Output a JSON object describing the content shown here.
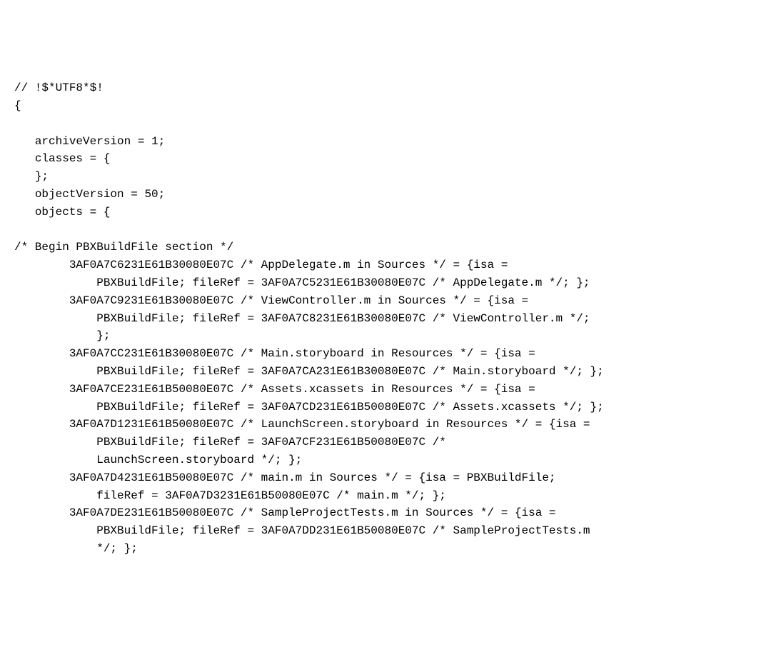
{
  "code": {
    "line1": "// !$*UTF8*$!",
    "line2": "{",
    "line3": "",
    "line4": "   archiveVersion = 1;",
    "line5": "   classes = {",
    "line6": "   };",
    "line7": "   objectVersion = 50;",
    "line8": "   objects = {",
    "line9": "",
    "line10": "/* Begin PBXBuildFile section */",
    "line11": "        3AF0A7C6231E61B30080E07C /* AppDelegate.m in Sources */ = {isa =",
    "line12": "            PBXBuildFile; fileRef = 3AF0A7C5231E61B30080E07C /* AppDelegate.m */; };",
    "line13": "        3AF0A7C9231E61B30080E07C /* ViewController.m in Sources */ = {isa =",
    "line14": "            PBXBuildFile; fileRef = 3AF0A7C8231E61B30080E07C /* ViewController.m */;",
    "line15": "            };",
    "line16": "        3AF0A7CC231E61B30080E07C /* Main.storyboard in Resources */ = {isa =",
    "line17": "            PBXBuildFile; fileRef = 3AF0A7CA231E61B30080E07C /* Main.storyboard */; };",
    "line18": "        3AF0A7CE231E61B50080E07C /* Assets.xcassets in Resources */ = {isa =",
    "line19": "            PBXBuildFile; fileRef = 3AF0A7CD231E61B50080E07C /* Assets.xcassets */; };",
    "line20": "        3AF0A7D1231E61B50080E07C /* LaunchScreen.storyboard in Resources */ = {isa =",
    "line21": "            PBXBuildFile; fileRef = 3AF0A7CF231E61B50080E07C /*",
    "line22": "            LaunchScreen.storyboard */; };",
    "line23": "        3AF0A7D4231E61B50080E07C /* main.m in Sources */ = {isa = PBXBuildFile;",
    "line24": "            fileRef = 3AF0A7D3231E61B50080E07C /* main.m */; };",
    "line25": "        3AF0A7DE231E61B50080E07C /* SampleProjectTests.m in Sources */ = {isa =",
    "line26": "            PBXBuildFile; fileRef = 3AF0A7DD231E61B50080E07C /* SampleProjectTests.m",
    "line27": "            */; };"
  }
}
